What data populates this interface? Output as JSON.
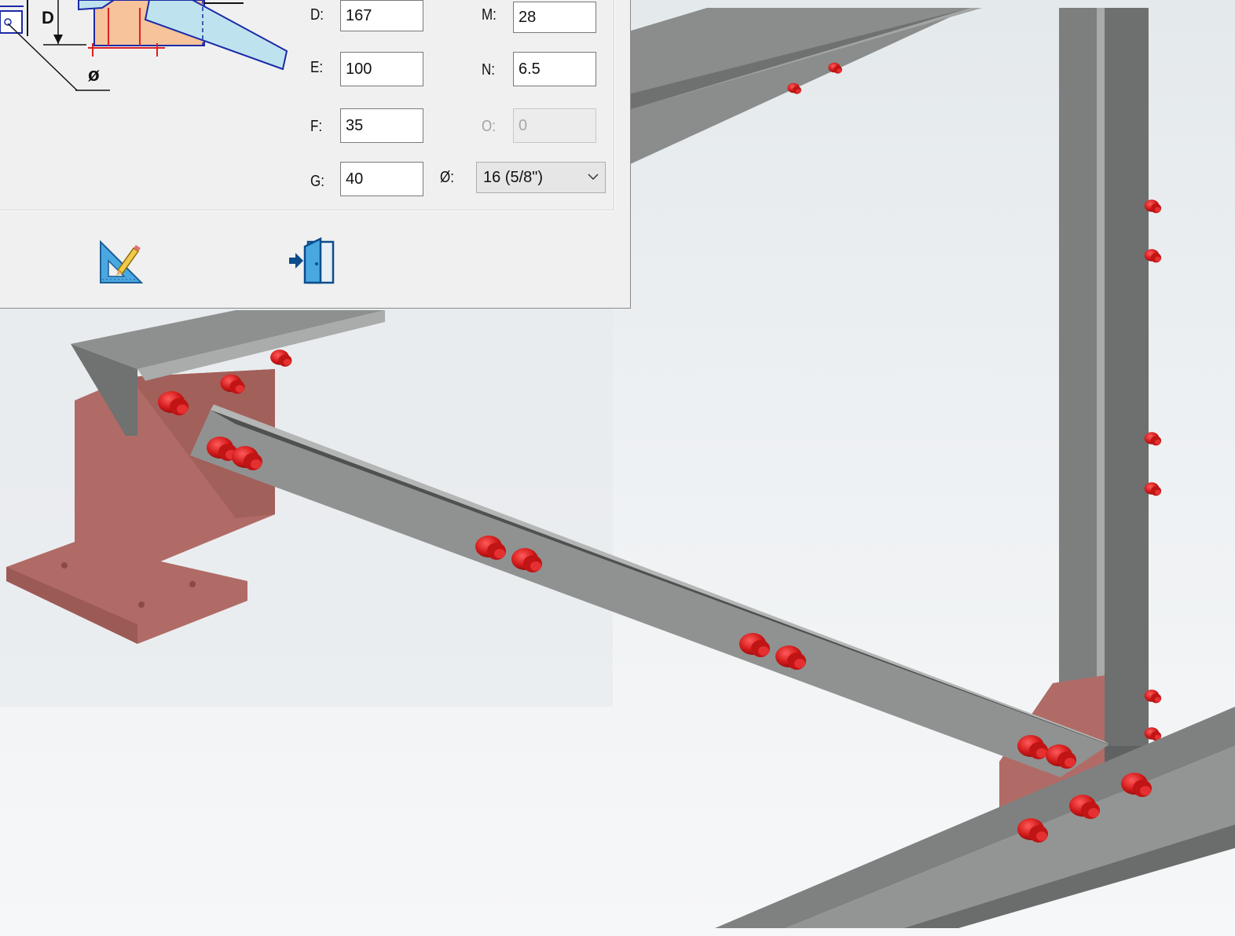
{
  "dialog": {
    "fields": {
      "D": {
        "label": "D:",
        "value": "167"
      },
      "E": {
        "label": "E:",
        "value": "100"
      },
      "F": {
        "label": "F:",
        "value": "35"
      },
      "G": {
        "label": "G:",
        "value": "40"
      },
      "M": {
        "label": "M:",
        "value": "28"
      },
      "N": {
        "label": "N:",
        "value": "6.5"
      },
      "O": {
        "label": "O:",
        "value": "0"
      }
    },
    "diameter": {
      "label": "Ø:",
      "value": "16 (5/8\")"
    },
    "schematic": {
      "dim_label_d": "D",
      "diameter_symbol": "ø"
    },
    "toolbar": {
      "draw_icon": "set-square-pencil-icon",
      "insert_icon": "door-arrow-in-icon"
    }
  },
  "scene": {
    "steel_color": "#8e9190",
    "steel_dark": "#6f7271",
    "plate_color": "#b06b66",
    "bolt_color": "#d21a1a"
  }
}
